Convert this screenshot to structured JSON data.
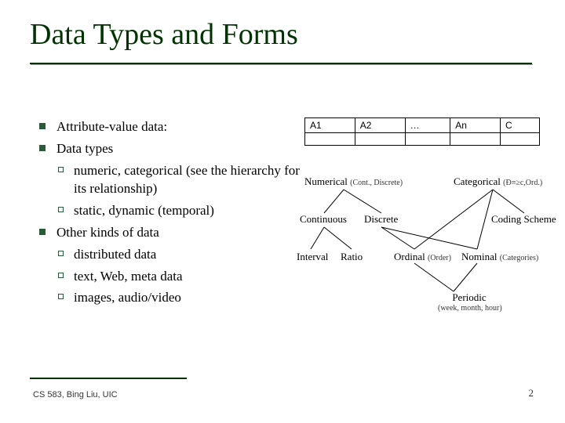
{
  "title": "Data Types and Forms",
  "bullets": {
    "b1": "Attribute-value data:",
    "b2": "Data types",
    "b2a": "numeric, categorical (see the hierarchy for its relationship)",
    "b2b": "static, dynamic (temporal)",
    "b3": "Other kinds of data",
    "b3a": "distributed data",
    "b3b": "text, Web, meta data",
    "b3c": "images, audio/video"
  },
  "table": {
    "h1": "A1",
    "h2": "A2",
    "h3": "…",
    "h4": "An",
    "h5": "C"
  },
  "diagram": {
    "numerical": "Numerical",
    "numerical_note": "(Cont., Discrete)",
    "categorical": "Categorical",
    "categorical_note": "(Đ≡≥c,Ord.)",
    "continuous": "Continuous",
    "discrete": "Discrete",
    "coding": "Coding Scheme",
    "interval": "Interval",
    "ratio": "Ratio",
    "ordinal": "Ordinal",
    "ordinal_note": "(Order)",
    "nominal": "Nominal",
    "nominal_note": "(Categories)",
    "periodic": "Periodic",
    "periodic_note": "(week, month, hour)"
  },
  "footer": {
    "left": "CS 583, Bing Liu, UIC",
    "right": "2"
  }
}
